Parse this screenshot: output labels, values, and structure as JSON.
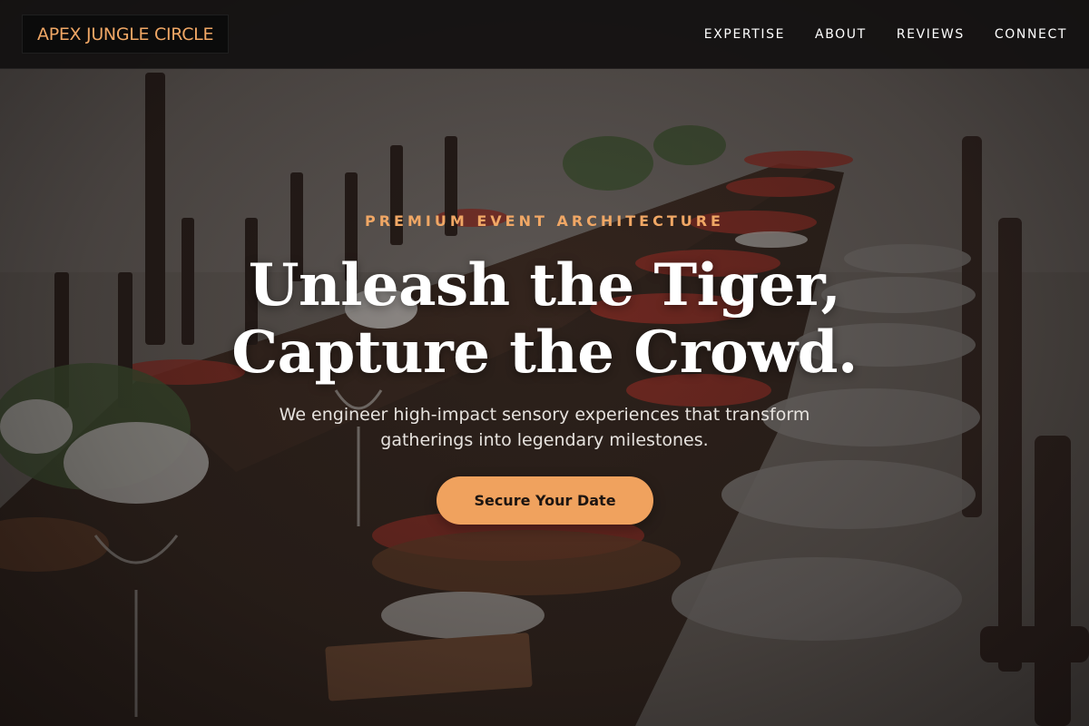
{
  "brand": {
    "name": "APEX JUNGLE CIRCLE"
  },
  "nav": {
    "items": [
      {
        "label": "EXPERTISE"
      },
      {
        "label": "ABOUT"
      },
      {
        "label": "REVIEWS"
      },
      {
        "label": "CONNECT"
      }
    ]
  },
  "hero": {
    "eyebrow": "PREMIUM EVENT ARCHITECTURE",
    "headline_line1": "Unleash the Tiger,",
    "headline_line2": "Capture the Crowd.",
    "subtext_line1": "We engineer high-impact sensory experiences that transform",
    "subtext_line2": "gatherings into legendary milestones.",
    "cta_label": "Secure Your Date",
    "background_image": "outdoor-banquet-table-photo"
  },
  "colors": {
    "accent": "#f0a765",
    "cta_background": "#f0a25e",
    "nav_background": "#121010",
    "text_primary": "#ffffff"
  }
}
